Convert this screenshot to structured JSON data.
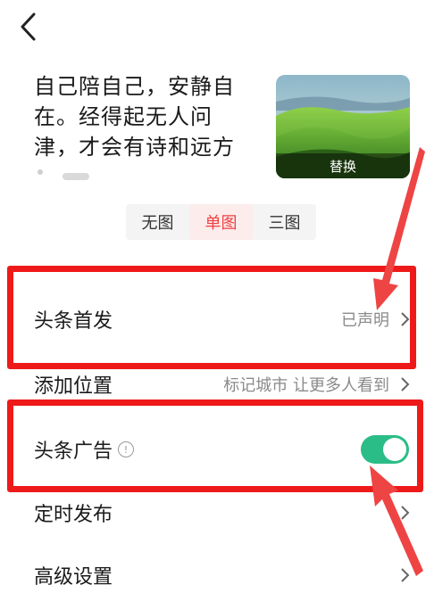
{
  "post": {
    "text": "自己陪自己，安静自在。经得起无人问津，才会有诗和远方",
    "cover_label": "替换"
  },
  "layout_tabs": [
    {
      "label": "无图",
      "active": false
    },
    {
      "label": "单图",
      "active": true
    },
    {
      "label": "三图",
      "active": false
    }
  ],
  "settings": {
    "first_publish": {
      "label": "头条首发",
      "value": "已声明"
    },
    "location": {
      "label": "添加位置",
      "value": "标记城市 让更多人看到"
    },
    "ads": {
      "label": "头条广告",
      "enabled": true
    },
    "scheduled": {
      "label": "定时发布"
    },
    "advanced": {
      "label": "高级设置"
    }
  },
  "colors": {
    "accent": "#f04142",
    "toggle_on": "#2bbd87",
    "highlight": "#ee1a1a"
  },
  "icons": [
    "back-arrow-icon",
    "chevron-right-icon",
    "info-circle-icon"
  ]
}
